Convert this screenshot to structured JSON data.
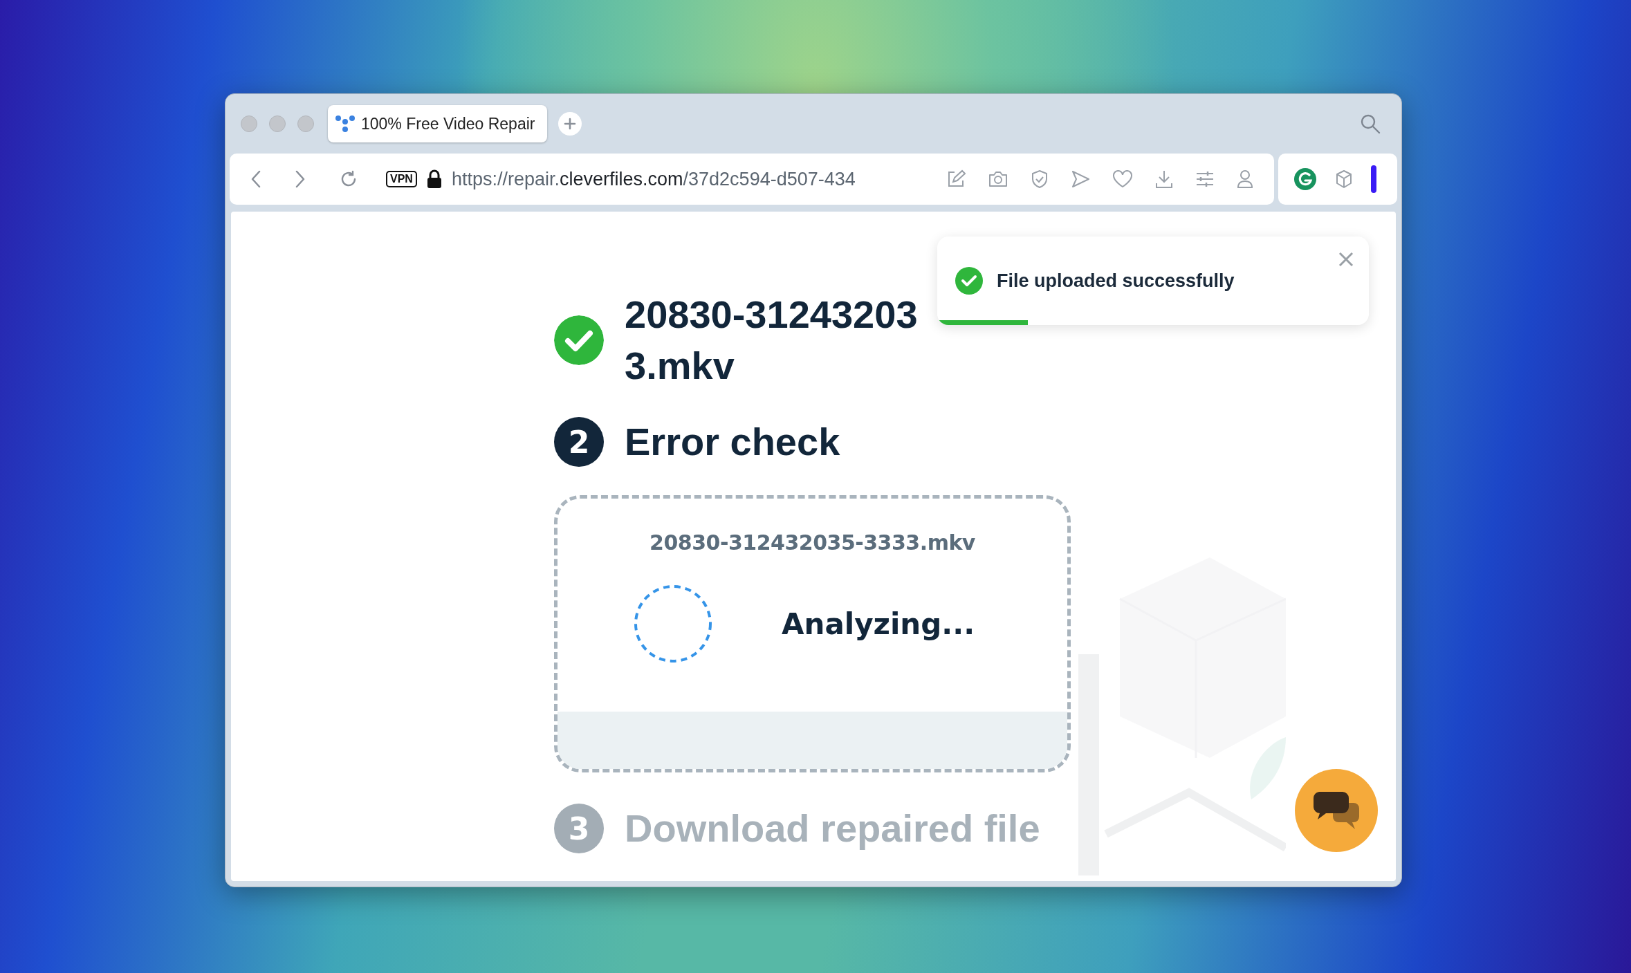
{
  "browser": {
    "tabs": [
      {
        "title": "100% Free Video Repair",
        "selected": true
      }
    ],
    "address_bar": {
      "vpn_badge": "VPN",
      "url": {
        "scheme_subdomain": "https://repair.",
        "domain": "cleverfiles.com",
        "path": "/37d2c594-d507-434"
      }
    }
  },
  "steps": [
    {
      "kind": "done",
      "title": "20830-31243203\n3.mkv"
    },
    {
      "kind": "current",
      "number": "2",
      "title": "Error check"
    },
    {
      "kind": "pending",
      "number": "3",
      "title": "Download repaired file"
    }
  ],
  "analysis_card": {
    "filename": "20830-312432035-3333.mkv",
    "status": "Analyzing..."
  },
  "toast": {
    "message": "File uploaded successfully",
    "level": 0.21
  }
}
